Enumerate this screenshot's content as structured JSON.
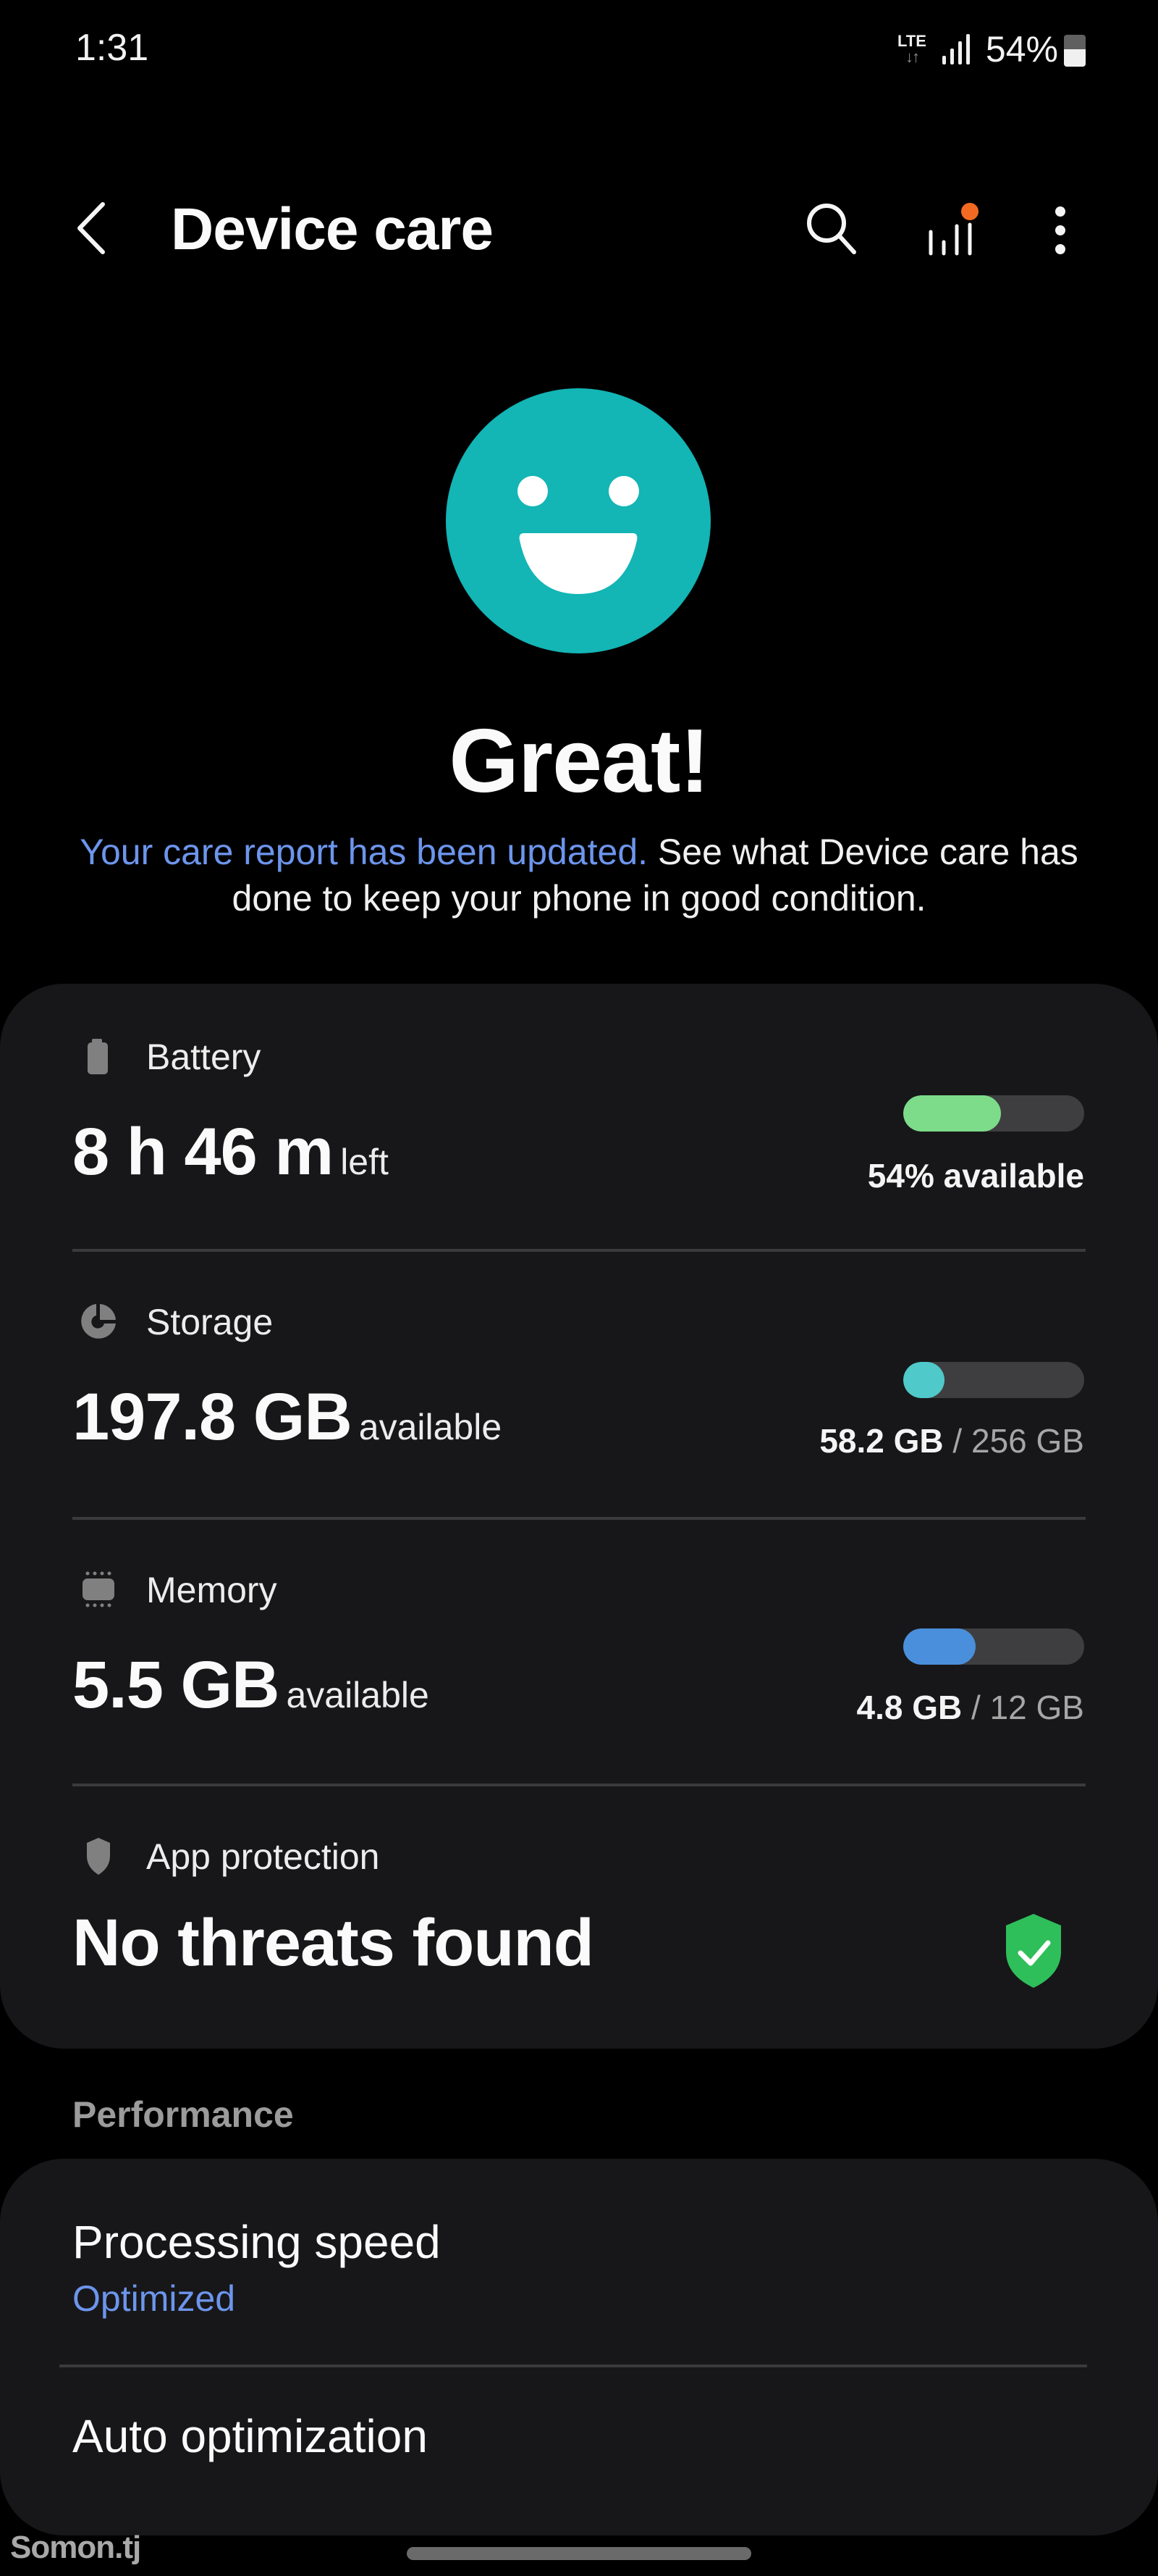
{
  "status_bar": {
    "time": "1:31",
    "network": "LTE",
    "network_arrows": "↓↑",
    "battery_percent": "54%",
    "battery_level": 0.54
  },
  "app_bar": {
    "title": "Device care",
    "icons": [
      "back-icon",
      "search-icon",
      "report-icon",
      "more-options-icon"
    ],
    "report_badge_color": "#f26a22"
  },
  "hero": {
    "icon": "smiley-face-icon",
    "icon_color": "#13b5b5",
    "title": "Great!",
    "link_text": "Your care report has been updated.",
    "description": " See what Device care has done to keep your phone in good condition.",
    "link_color": "#6c95ec"
  },
  "status_card": {
    "battery": {
      "label": "Battery",
      "icon": "battery-icon",
      "value": "8 h 46 m",
      "value_suffix": "left",
      "caption": "54% available",
      "fraction": 0.54,
      "color": "#7ddc8a"
    },
    "storage": {
      "label": "Storage",
      "icon": "storage-pie-icon",
      "value": "197.8 GB",
      "value_suffix": "available",
      "used": "58.2 GB",
      "separator": " / ",
      "total": "256 GB",
      "fraction": 0.227,
      "color": "#4fc9c9"
    },
    "memory": {
      "label": "Memory",
      "icon": "memory-chip-icon",
      "value": "5.5 GB",
      "value_suffix": "available",
      "used": "4.8 GB",
      "separator": " / ",
      "total": "12 GB",
      "fraction": 0.4,
      "color": "#4a8fdb"
    },
    "app_protection": {
      "label": "App protection",
      "icon": "shield-icon",
      "value": "No threats found",
      "status_icon": "shield-check-icon",
      "status_color": "#2fbf5a"
    }
  },
  "performance": {
    "section_label": "Performance",
    "items": [
      {
        "title": "Processing speed",
        "subtitle": "Optimized"
      },
      {
        "title": "Auto optimization"
      }
    ]
  },
  "watermark": "Somon.tj"
}
